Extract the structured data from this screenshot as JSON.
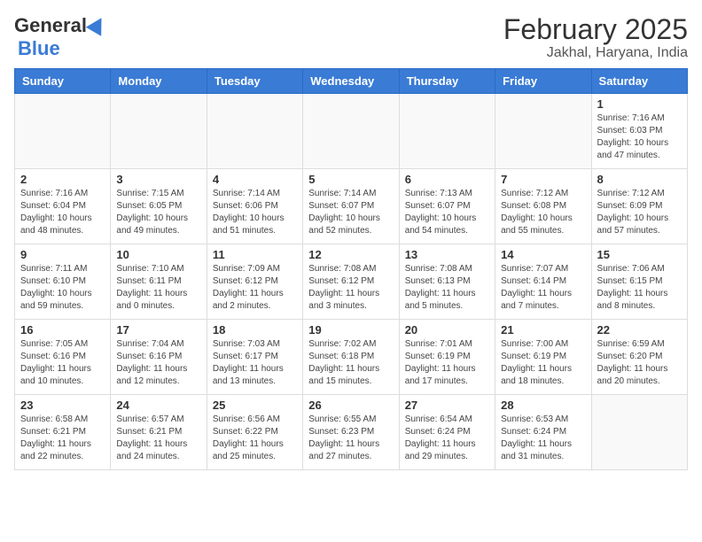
{
  "header": {
    "logo_general": "General",
    "logo_blue": "Blue",
    "title": "February 2025",
    "subtitle": "Jakhal, Haryana, India"
  },
  "days_of_week": [
    "Sunday",
    "Monday",
    "Tuesday",
    "Wednesday",
    "Thursday",
    "Friday",
    "Saturday"
  ],
  "weeks": [
    [
      {
        "day": "",
        "info": ""
      },
      {
        "day": "",
        "info": ""
      },
      {
        "day": "",
        "info": ""
      },
      {
        "day": "",
        "info": ""
      },
      {
        "day": "",
        "info": ""
      },
      {
        "day": "",
        "info": ""
      },
      {
        "day": "1",
        "info": "Sunrise: 7:16 AM\nSunset: 6:03 PM\nDaylight: 10 hours and 47 minutes."
      }
    ],
    [
      {
        "day": "2",
        "info": "Sunrise: 7:16 AM\nSunset: 6:04 PM\nDaylight: 10 hours and 48 minutes."
      },
      {
        "day": "3",
        "info": "Sunrise: 7:15 AM\nSunset: 6:05 PM\nDaylight: 10 hours and 49 minutes."
      },
      {
        "day": "4",
        "info": "Sunrise: 7:14 AM\nSunset: 6:06 PM\nDaylight: 10 hours and 51 minutes."
      },
      {
        "day": "5",
        "info": "Sunrise: 7:14 AM\nSunset: 6:07 PM\nDaylight: 10 hours and 52 minutes."
      },
      {
        "day": "6",
        "info": "Sunrise: 7:13 AM\nSunset: 6:07 PM\nDaylight: 10 hours and 54 minutes."
      },
      {
        "day": "7",
        "info": "Sunrise: 7:12 AM\nSunset: 6:08 PM\nDaylight: 10 hours and 55 minutes."
      },
      {
        "day": "8",
        "info": "Sunrise: 7:12 AM\nSunset: 6:09 PM\nDaylight: 10 hours and 57 minutes."
      }
    ],
    [
      {
        "day": "9",
        "info": "Sunrise: 7:11 AM\nSunset: 6:10 PM\nDaylight: 10 hours and 59 minutes."
      },
      {
        "day": "10",
        "info": "Sunrise: 7:10 AM\nSunset: 6:11 PM\nDaylight: 11 hours and 0 minutes."
      },
      {
        "day": "11",
        "info": "Sunrise: 7:09 AM\nSunset: 6:12 PM\nDaylight: 11 hours and 2 minutes."
      },
      {
        "day": "12",
        "info": "Sunrise: 7:08 AM\nSunset: 6:12 PM\nDaylight: 11 hours and 3 minutes."
      },
      {
        "day": "13",
        "info": "Sunrise: 7:08 AM\nSunset: 6:13 PM\nDaylight: 11 hours and 5 minutes."
      },
      {
        "day": "14",
        "info": "Sunrise: 7:07 AM\nSunset: 6:14 PM\nDaylight: 11 hours and 7 minutes."
      },
      {
        "day": "15",
        "info": "Sunrise: 7:06 AM\nSunset: 6:15 PM\nDaylight: 11 hours and 8 minutes."
      }
    ],
    [
      {
        "day": "16",
        "info": "Sunrise: 7:05 AM\nSunset: 6:16 PM\nDaylight: 11 hours and 10 minutes."
      },
      {
        "day": "17",
        "info": "Sunrise: 7:04 AM\nSunset: 6:16 PM\nDaylight: 11 hours and 12 minutes."
      },
      {
        "day": "18",
        "info": "Sunrise: 7:03 AM\nSunset: 6:17 PM\nDaylight: 11 hours and 13 minutes."
      },
      {
        "day": "19",
        "info": "Sunrise: 7:02 AM\nSunset: 6:18 PM\nDaylight: 11 hours and 15 minutes."
      },
      {
        "day": "20",
        "info": "Sunrise: 7:01 AM\nSunset: 6:19 PM\nDaylight: 11 hours and 17 minutes."
      },
      {
        "day": "21",
        "info": "Sunrise: 7:00 AM\nSunset: 6:19 PM\nDaylight: 11 hours and 18 minutes."
      },
      {
        "day": "22",
        "info": "Sunrise: 6:59 AM\nSunset: 6:20 PM\nDaylight: 11 hours and 20 minutes."
      }
    ],
    [
      {
        "day": "23",
        "info": "Sunrise: 6:58 AM\nSunset: 6:21 PM\nDaylight: 11 hours and 22 minutes."
      },
      {
        "day": "24",
        "info": "Sunrise: 6:57 AM\nSunset: 6:21 PM\nDaylight: 11 hours and 24 minutes."
      },
      {
        "day": "25",
        "info": "Sunrise: 6:56 AM\nSunset: 6:22 PM\nDaylight: 11 hours and 25 minutes."
      },
      {
        "day": "26",
        "info": "Sunrise: 6:55 AM\nSunset: 6:23 PM\nDaylight: 11 hours and 27 minutes."
      },
      {
        "day": "27",
        "info": "Sunrise: 6:54 AM\nSunset: 6:24 PM\nDaylight: 11 hours and 29 minutes."
      },
      {
        "day": "28",
        "info": "Sunrise: 6:53 AM\nSunset: 6:24 PM\nDaylight: 11 hours and 31 minutes."
      },
      {
        "day": "",
        "info": ""
      }
    ]
  ]
}
